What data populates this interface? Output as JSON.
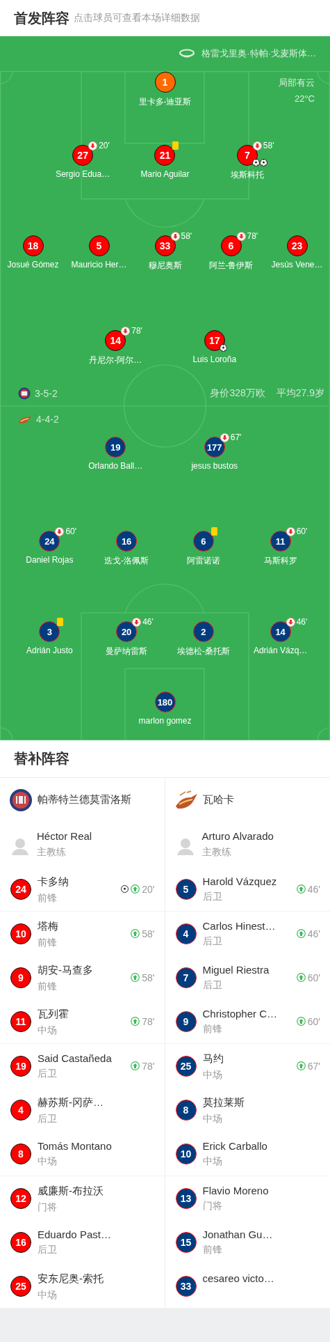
{
  "header": {
    "title": "首发阵容",
    "hint": "点击球员可查看本场详细数据"
  },
  "venue": {
    "stadium": "格雷戈里奥·特帕·戈麦斯体…",
    "weather": "局部有云",
    "temperature": "22°C"
  },
  "home": {
    "formation": "3-5-2",
    "market_value": "身价328万欧",
    "average_age": "平均27.9岁",
    "lines": [
      {
        "players": [
          {
            "number": "1",
            "name": "里卡多-迪亚斯",
            "color": "#ff6a00"
          }
        ]
      },
      {
        "players": [
          {
            "number": "27",
            "name": "Sergio Edua…",
            "color": "#ff0000",
            "events": [
              {
                "kind": "sub_out",
                "minute": "20'"
              }
            ]
          },
          {
            "number": "21",
            "name": "Mario Aguilar",
            "color": "#ff0000",
            "events": [
              {
                "kind": "yellow_card"
              }
            ]
          },
          {
            "number": "7",
            "name": "埃斯科托",
            "color": "#ff0000",
            "events": [
              {
                "kind": "sub_out",
                "minute": "58'"
              },
              {
                "kind": "goal"
              },
              {
                "kind": "goal"
              }
            ]
          }
        ]
      },
      {
        "players": [
          {
            "number": "18",
            "name": "Josué Gómez",
            "color": "#ff0000"
          },
          {
            "number": "5",
            "name": "Mauricio Her…",
            "color": "#ff0000"
          },
          {
            "number": "33",
            "name": "穆尼奥斯",
            "color": "#ff0000",
            "events": [
              {
                "kind": "sub_out",
                "minute": "58'"
              }
            ]
          },
          {
            "number": "6",
            "name": "阿兰-鲁伊斯",
            "color": "#ff0000",
            "events": [
              {
                "kind": "sub_out",
                "minute": "78'"
              }
            ]
          },
          {
            "number": "23",
            "name": "Jesús Vene…",
            "color": "#ff0000"
          }
        ]
      },
      {
        "players": [
          {
            "number": "14",
            "name": "丹尼尔-阿尔…",
            "color": "#ff0000",
            "events": [
              {
                "kind": "sub_out",
                "minute": "78'"
              }
            ]
          },
          {
            "number": "17",
            "name": "Luis Loroña",
            "color": "#ff0000",
            "events": [
              {
                "kind": "goal"
              }
            ]
          }
        ]
      }
    ]
  },
  "away": {
    "formation": "4-4-2",
    "lines": [
      {
        "players": [
          {
            "number": "19",
            "name": "Orlando Ball…",
            "color": "#003c7e"
          },
          {
            "number": "177",
            "name": "jesus bustos",
            "color": "#003c7e",
            "events": [
              {
                "kind": "sub_out",
                "minute": "67'"
              }
            ]
          }
        ]
      },
      {
        "players": [
          {
            "number": "24",
            "name": "Daniel Rojas",
            "color": "#003c7e",
            "events": [
              {
                "kind": "sub_out",
                "minute": "60'"
              }
            ]
          },
          {
            "number": "16",
            "name": "迭戈-洛佩斯",
            "color": "#003c7e"
          },
          {
            "number": "6",
            "name": "阿雷诺诺",
            "color": "#003c7e",
            "events": [
              {
                "kind": "yellow_card"
              }
            ]
          },
          {
            "number": "11",
            "name": "马斯科罗",
            "color": "#003c7e",
            "events": [
              {
                "kind": "sub_out",
                "minute": "60'"
              }
            ]
          }
        ]
      },
      {
        "players": [
          {
            "number": "3",
            "name": "Adrián Justo",
            "color": "#003c7e",
            "events": [
              {
                "kind": "yellow_card"
              }
            ]
          },
          {
            "number": "20",
            "name": "曼萨纳雷斯",
            "color": "#003c7e",
            "events": [
              {
                "kind": "sub_out",
                "minute": "46'"
              }
            ]
          },
          {
            "number": "2",
            "name": "埃德松-桑托斯",
            "color": "#003c7e"
          },
          {
            "number": "14",
            "name": "Adrián Vázq…",
            "color": "#003c7e",
            "events": [
              {
                "kind": "sub_out",
                "minute": "46'"
              }
            ]
          }
        ]
      },
      {
        "players": [
          {
            "number": "180",
            "name": "marlon gomez",
            "color": "#003c7e"
          }
        ]
      }
    ]
  },
  "subs": {
    "title": "替补阵容",
    "teams": [
      {
        "kind": "home",
        "name": "帕蒂特兰德莫雷洛斯",
        "coach": {
          "name": "Héctor Real",
          "role": "主教练"
        },
        "players": [
          {
            "number": "24",
            "name": "卡多纳",
            "position": "前锋",
            "events": [
              {
                "kind": "goal"
              },
              {
                "kind": "sub_in",
                "minute": "20'"
              }
            ]
          },
          {
            "number": "10",
            "name": "塔梅",
            "position": "前锋",
            "events": [
              {
                "kind": "sub_in",
                "minute": "58'"
              }
            ]
          },
          {
            "number": "9",
            "name": "胡安-马查多",
            "position": "前锋",
            "events": [
              {
                "kind": "sub_in",
                "minute": "58'"
              }
            ]
          },
          {
            "number": "11",
            "name": "瓦列霍",
            "position": "中场",
            "events": [
              {
                "kind": "sub_in",
                "minute": "78'"
              }
            ]
          },
          {
            "number": "19",
            "name": "Said Castañeda",
            "position": "后卫",
            "events": [
              {
                "kind": "sub_in",
                "minute": "78'"
              }
            ]
          },
          {
            "number": "4",
            "name": "赫苏斯-冈萨…",
            "position": "后卫"
          },
          {
            "number": "8",
            "name": "Tomás Montano",
            "position": "中场"
          },
          {
            "number": "12",
            "name": "威廉斯-布拉沃",
            "position": "门将"
          },
          {
            "number": "16",
            "name": "Eduardo Past…",
            "position": "后卫"
          },
          {
            "number": "25",
            "name": "安东尼奥-索托",
            "position": "中场"
          }
        ]
      },
      {
        "kind": "away",
        "name": "瓦哈卡",
        "coach": {
          "name": "Arturo Alvarado",
          "role": "主教练"
        },
        "players": [
          {
            "number": "5",
            "name": "Harold Vázquez",
            "position": "后卫",
            "events": [
              {
                "kind": "sub_in",
                "minute": "46'"
              }
            ]
          },
          {
            "number": "4",
            "name": "Carlos Hinest…",
            "position": "后卫",
            "events": [
              {
                "kind": "sub_in",
                "minute": "46'"
              }
            ]
          },
          {
            "number": "7",
            "name": "Miguel Riestra",
            "position": "后卫",
            "events": [
              {
                "kind": "sub_in",
                "minute": "60'"
              }
            ]
          },
          {
            "number": "9",
            "name": "Christopher C…",
            "position": "前锋",
            "events": [
              {
                "kind": "sub_in",
                "minute": "60'"
              }
            ]
          },
          {
            "number": "25",
            "name": "马约",
            "position": "中场",
            "events": [
              {
                "kind": "sub_in",
                "minute": "67'"
              }
            ]
          },
          {
            "number": "8",
            "name": "莫拉莱斯",
            "position": "中场"
          },
          {
            "number": "10",
            "name": "Erick Carballo",
            "position": "中场"
          },
          {
            "number": "13",
            "name": "Flavio Moreno",
            "position": "门将"
          },
          {
            "number": "15",
            "name": "Jonathan Gu…",
            "position": "前锋"
          },
          {
            "number": "33",
            "name": "cesareo victo…"
          }
        ]
      }
    ]
  }
}
